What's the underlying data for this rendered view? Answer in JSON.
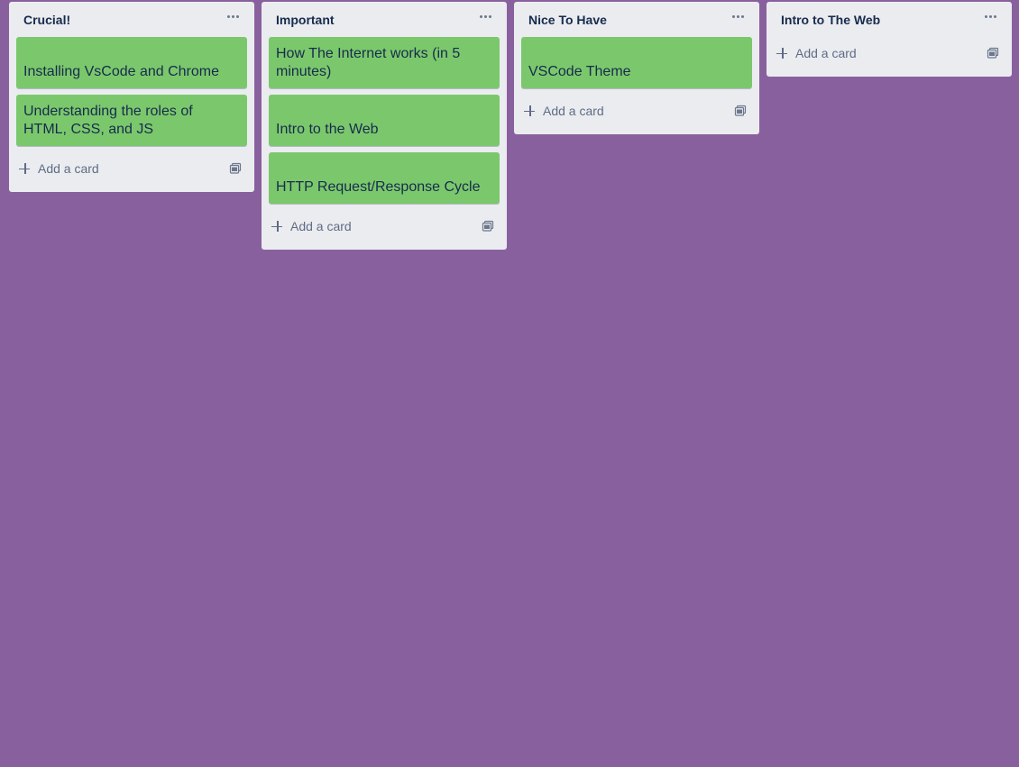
{
  "board": {
    "background": "#89609e",
    "lists": [
      {
        "title": "Crucial!",
        "cards": [
          "Installing VsCode and Chrome",
          "Understanding the roles of HTML, CSS, and JS"
        ],
        "add_card_label": "Add a card"
      },
      {
        "title": "Important",
        "cards": [
          "How The Internet works (in 5 minutes)",
          "Intro to the Web",
          "HTTP Request/Response Cycle"
        ],
        "add_card_label": "Add a card"
      },
      {
        "title": "Nice To Have",
        "cards": [
          "VSCode Theme"
        ],
        "add_card_label": "Add a card"
      },
      {
        "title": "Intro to The Web",
        "cards": [],
        "add_card_label": "Add a card"
      }
    ]
  },
  "colors": {
    "card": "#7bc86c",
    "list": "#ebecf0",
    "title_text": "#172b4d",
    "muted_text": "#5e6c84"
  },
  "icons": {
    "list_menu": "ellipsis-icon",
    "add": "plus-icon",
    "template": "card-template-icon"
  }
}
